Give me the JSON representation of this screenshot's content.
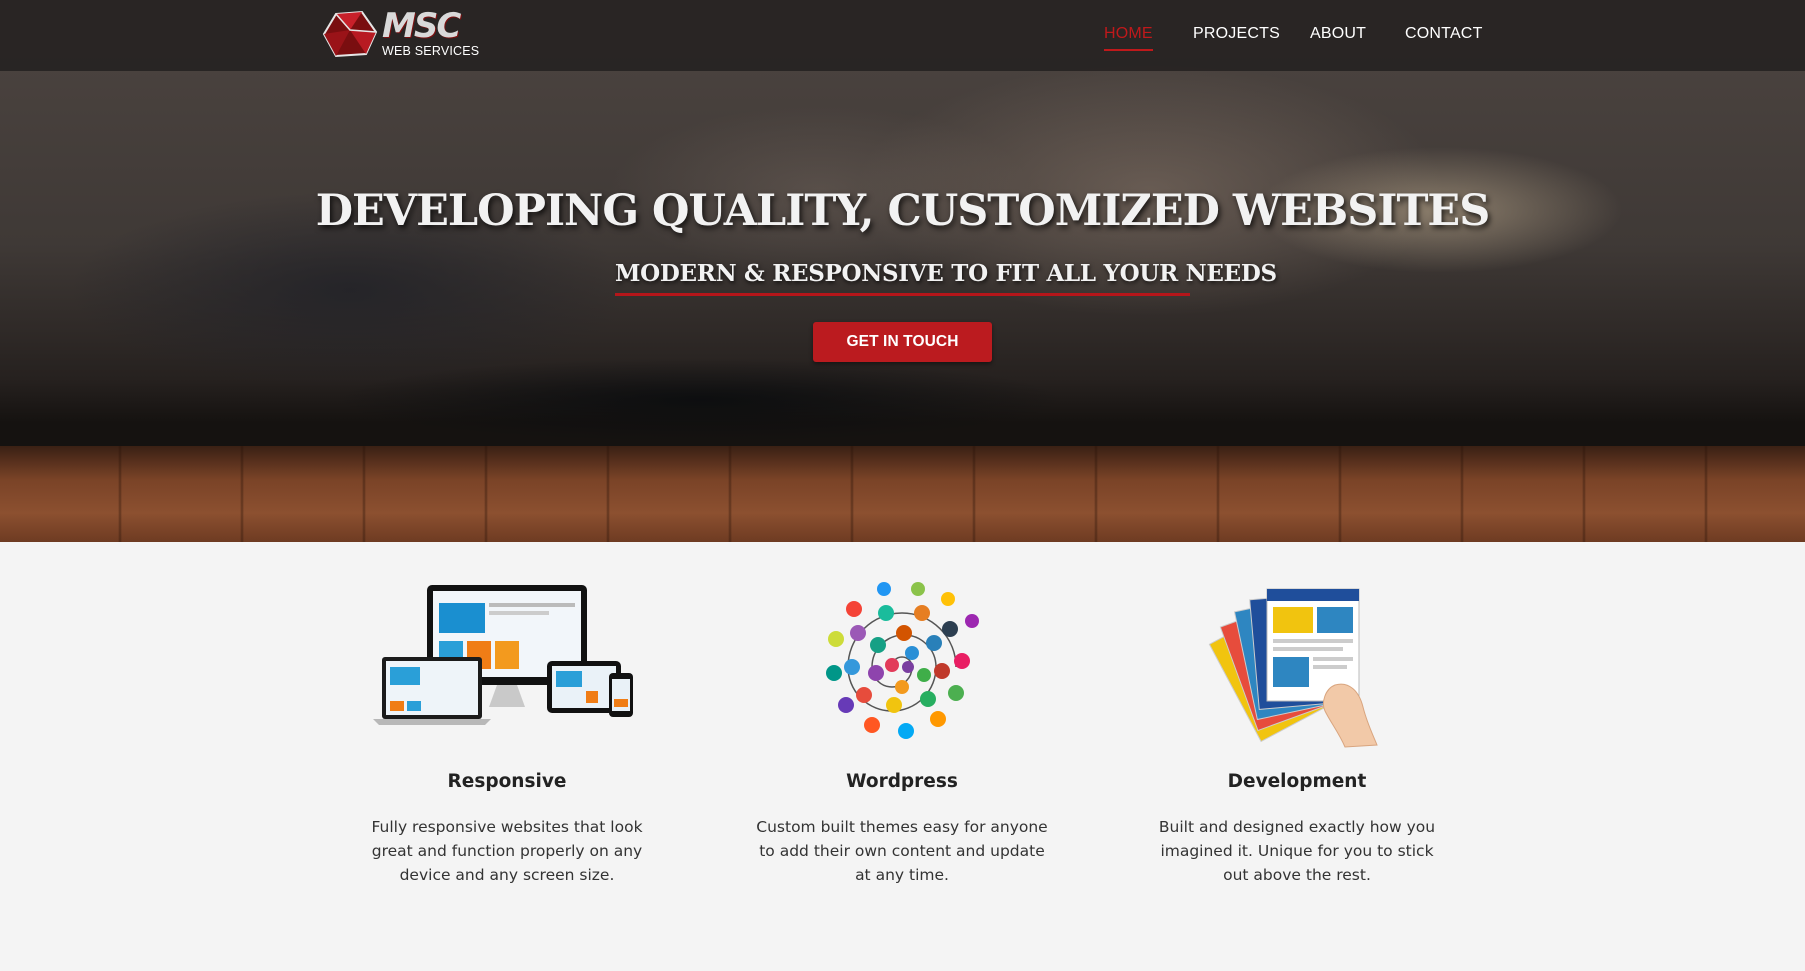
{
  "brand": {
    "logo_text": "MSC",
    "logo_sub": "WEB SERVICES"
  },
  "nav": {
    "items": [
      {
        "label": "HOME",
        "active": true
      },
      {
        "label": "PROJECTS",
        "active": false
      },
      {
        "label": "ABOUT",
        "active": false
      },
      {
        "label": "CONTACT",
        "active": false
      }
    ]
  },
  "hero": {
    "title": "DEVELOPING QUALITY, CUSTOMIZED WEBSITES",
    "subtitle": "MODERN & RESPONSIVE TO FIT ALL YOUR NEEDS",
    "cta_label": "GET IN TOUCH"
  },
  "features": [
    {
      "title": "Responsive",
      "text": "Fully responsive websites that look great and function properly on any device and any screen size.",
      "icon": "devices-icon"
    },
    {
      "title": "Wordpress",
      "text": "Custom built themes easy for anyone to add their own content and update at any time.",
      "icon": "plugins-spiral-icon"
    },
    {
      "title": "Development",
      "text": "Built and designed exactly how you imagined it. Unique for you to stick out above the rest.",
      "icon": "hand-holding-pages-icon"
    }
  ],
  "colors": {
    "accent": "#c0191b",
    "navbar": "#262322",
    "body_bg": "#f4f4f4"
  }
}
